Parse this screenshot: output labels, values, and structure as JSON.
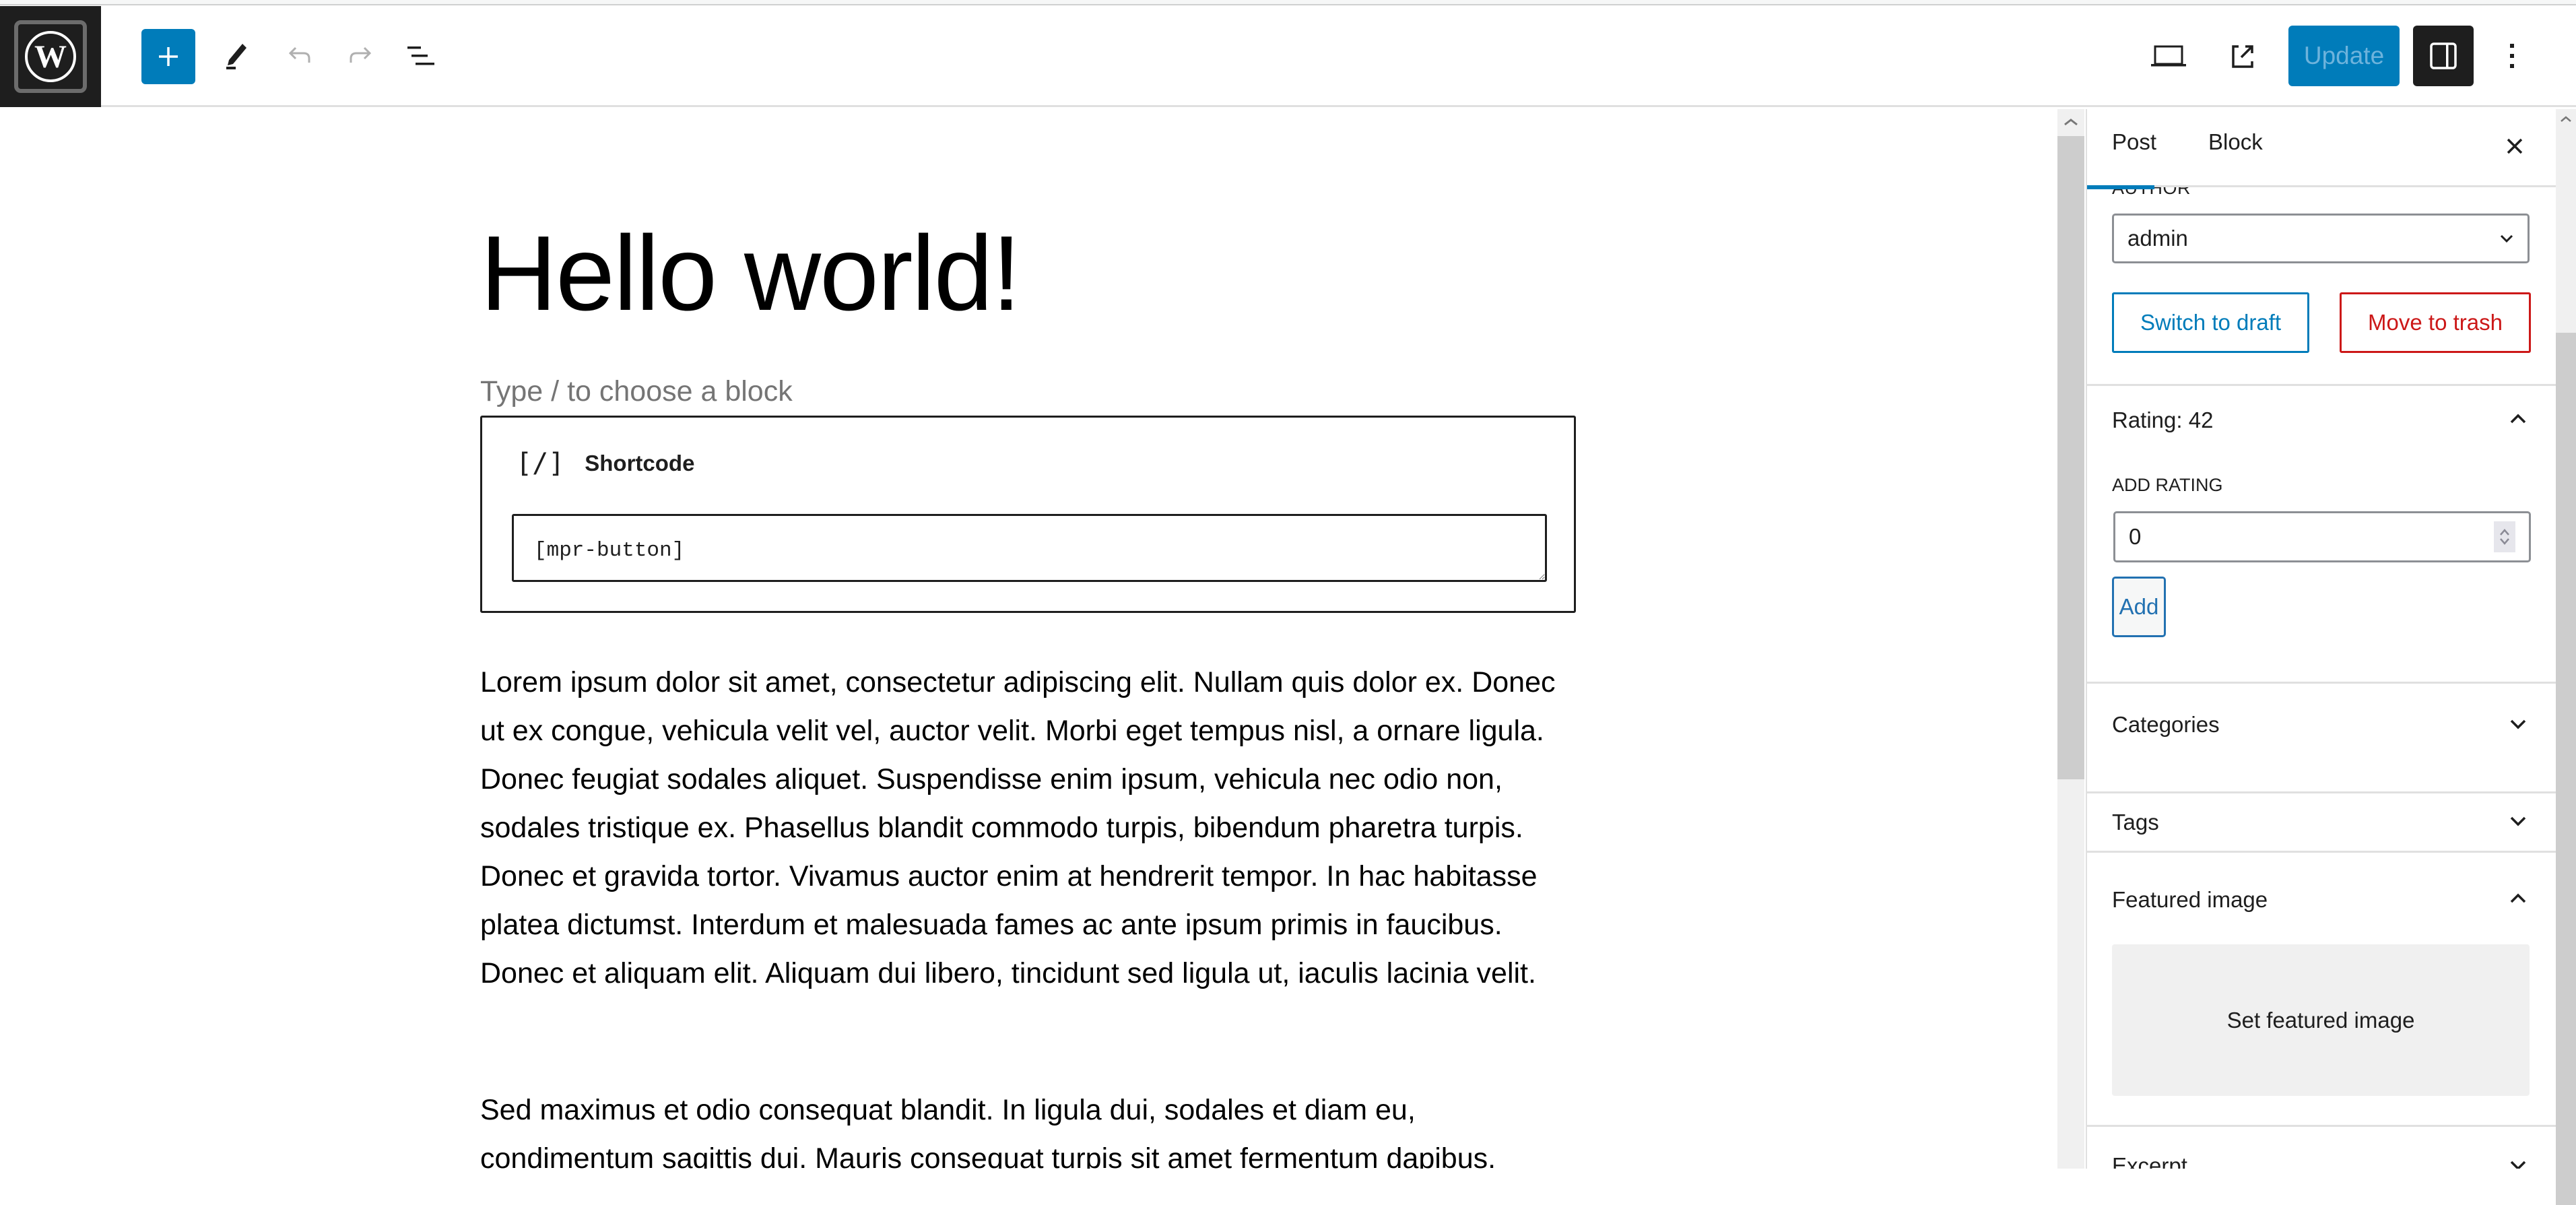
{
  "topbar": {
    "logo_icon": "wordpress-logo-icon",
    "left_tools": [
      {
        "name": "add-block",
        "icon": "plus-icon",
        "label": "Toggle block inserter"
      },
      {
        "name": "tools",
        "icon": "pencil-icon",
        "label": "Tools"
      },
      {
        "name": "undo",
        "icon": "undo-icon",
        "label": "Undo",
        "disabled": true
      },
      {
        "name": "redo",
        "icon": "redo-icon",
        "label": "Redo",
        "disabled": true
      },
      {
        "name": "document-overview",
        "icon": "list-view-icon",
        "label": "Document Overview"
      }
    ],
    "right_tools": [
      {
        "name": "preview",
        "icon": "laptop-icon",
        "label": "View"
      },
      {
        "name": "view-post",
        "icon": "external-link-icon",
        "label": "View Post"
      }
    ],
    "update_label": "Update",
    "settings_icon": "sidebar-toggle-icon",
    "options_icon": "more-vertical-icon",
    "accent_color": "#007cba"
  },
  "editor": {
    "title": "Hello world!",
    "appender_placeholder": "Type / to choose a block",
    "shortcode_block": {
      "icon_text": "[/]",
      "label": "Shortcode",
      "value": "[mpr-button]"
    },
    "paragraphs": [
      "Lorem ipsum dolor sit amet, consectetur adipiscing elit. Nullam quis dolor ex. Donec ut ex congue, vehicula velit vel, auctor velit. Morbi eget tempus nisl, a ornare ligula. Donec feugiat sodales aliquet. Suspendisse enim ipsum, vehicula nec odio non, sodales tristique ex. Phasellus blandit commodo turpis, bibendum pharetra turpis. Donec et gravida tortor. Vivamus auctor enim at hendrerit tempor. In hac habitasse platea dictumst. Interdum et malesuada fames ac ante ipsum primis in faucibus. Donec et aliquam elit. Aliquam dui libero, tincidunt sed ligula ut, iaculis lacinia velit.",
      "Sed maximus et odio consequat blandit. In ligula dui, sodales et diam eu, condimentum sagittis dui. Mauris consequat turpis sit amet fermentum dapibus."
    ]
  },
  "sidebar": {
    "tabs": [
      {
        "label": "Post",
        "active": true
      },
      {
        "label": "Block",
        "active": false
      }
    ],
    "close_icon": "close-icon",
    "author": {
      "label": "AUTHOR",
      "selected": "admin"
    },
    "switch_to_draft_label": "Switch to draft",
    "move_to_trash_label": "Move to trash",
    "rating_panel": {
      "title": "Rating: 42",
      "expanded": true,
      "input_label": "ADD RATING",
      "input_value": "0",
      "add_label": "Add"
    },
    "panels": [
      {
        "title": "Categories",
        "expanded": false
      },
      {
        "title": "Tags",
        "expanded": false
      },
      {
        "title": "Featured image",
        "expanded": true
      },
      {
        "title": "Excerpt",
        "expanded": false
      }
    ],
    "featured_image_button": "Set featured image",
    "danger_color": "#cc1818"
  }
}
